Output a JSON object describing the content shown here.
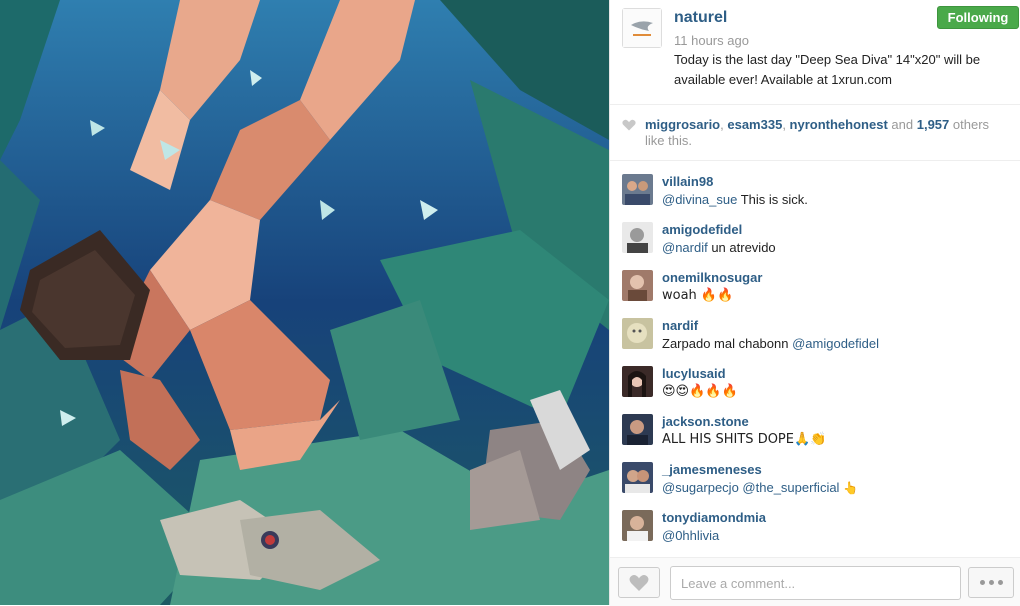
{
  "post": {
    "username": "naturel",
    "time_ago": "11 hours ago",
    "caption": "Today is the last day \"Deep Sea Diva\" 14\"x20\" will be available ever! Available at 1xrun.com",
    "follow_label": "Following"
  },
  "likes": {
    "users": [
      "miggrosario",
      "esam335",
      "nyronthehonest"
    ],
    "and_word": "and",
    "others_count": "1,957",
    "suffix": "others like this."
  },
  "comments": [
    {
      "user": "villain98",
      "mention": "@divina_sue",
      "text": " This is sick.",
      "avatar_color": "#6b7a8f"
    },
    {
      "user": "amigodefidel",
      "mention": "@nardif",
      "text": " un atrevido",
      "avatar_color": "#8f8f8f"
    },
    {
      "user": "onemilknosugar",
      "mention": "",
      "text": "woah 🔥🔥",
      "avatar_color": "#a07a6a"
    },
    {
      "user": "nardif",
      "mention": "",
      "text": "Zarpado mal chabonn ",
      "mention_after": "@amigodefidel",
      "avatar_color": "#b9b38a"
    },
    {
      "user": "lucylusaid",
      "mention": "",
      "text": "😍😍🔥🔥🔥",
      "avatar_color": "#3b2a28"
    },
    {
      "user": "jackson.stone",
      "mention": "",
      "text": "ALL HIS SHITS DOPE🙏👏",
      "avatar_color": "#2d3a52"
    },
    {
      "user": "_jamesmeneses",
      "mention": "@sugarpecjo",
      "text": " ",
      "mention_after": "@the_superficial",
      "tail": " 👆",
      "avatar_color": "#3a4a6a"
    },
    {
      "user": "tonydiamondmia",
      "mention": "@0hhlivia",
      "text": "",
      "avatar_color": "#7a6a5a"
    }
  ],
  "footer": {
    "comment_placeholder": "Leave a comment..."
  },
  "icons": {
    "like": "heart-icon",
    "more": "more-dots-icon"
  },
  "colors": {
    "link": "#2e5e86",
    "follow_green": "#4aa94a"
  }
}
